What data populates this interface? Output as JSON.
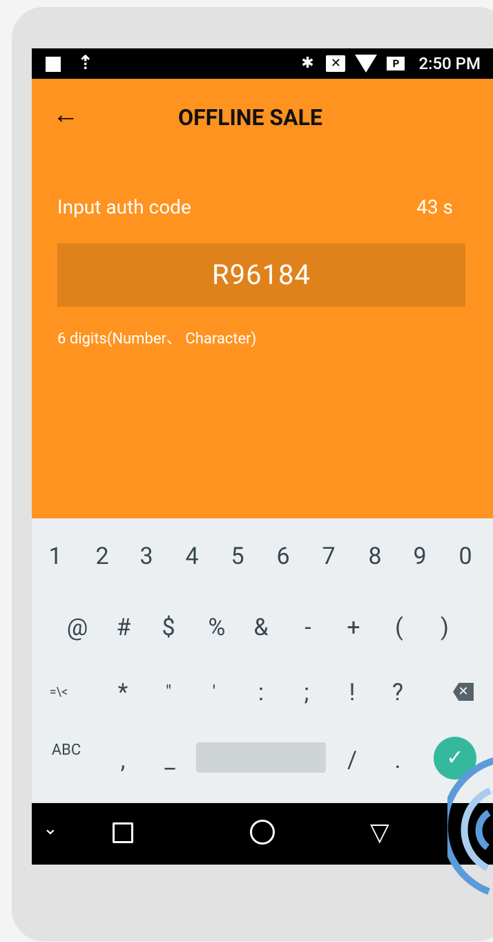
{
  "status_bar": {
    "time": "2:50 PM",
    "icons": [
      "notification-square-icon",
      "upload-icon",
      "bluetooth-icon",
      "no-sim-icon",
      "wifi-icon",
      "battery-icon"
    ]
  },
  "app_bar": {
    "back_icon": "←",
    "title": "OFFLINE SALE"
  },
  "auth": {
    "label": "Input auth code",
    "countdown": "43 s",
    "code_value": "R96184",
    "hint": "6 digits(Number、 Character)"
  },
  "keyboard": {
    "row1": [
      "1",
      "2",
      "3",
      "4",
      "5",
      "6",
      "7",
      "8",
      "9",
      "0"
    ],
    "row2": [
      "@",
      "#",
      "$",
      "%",
      "&",
      "-",
      "+",
      "(",
      ")"
    ],
    "row3": [
      "=\\<",
      "*",
      "\"",
      "'",
      ":",
      ";",
      "!",
      "?"
    ],
    "row4": [
      "ABC",
      ",",
      "_",
      "/",
      "."
    ],
    "backspace_label": "✕",
    "enter_label": "✓"
  },
  "nav_bar": {
    "hide_keyboard_icon": "⌄",
    "back_icon": "▽"
  },
  "colors": {
    "accent": "#ff9320",
    "field": "#e0821c",
    "enter": "#35b99c",
    "keyboard_bg": "#eceff1"
  }
}
